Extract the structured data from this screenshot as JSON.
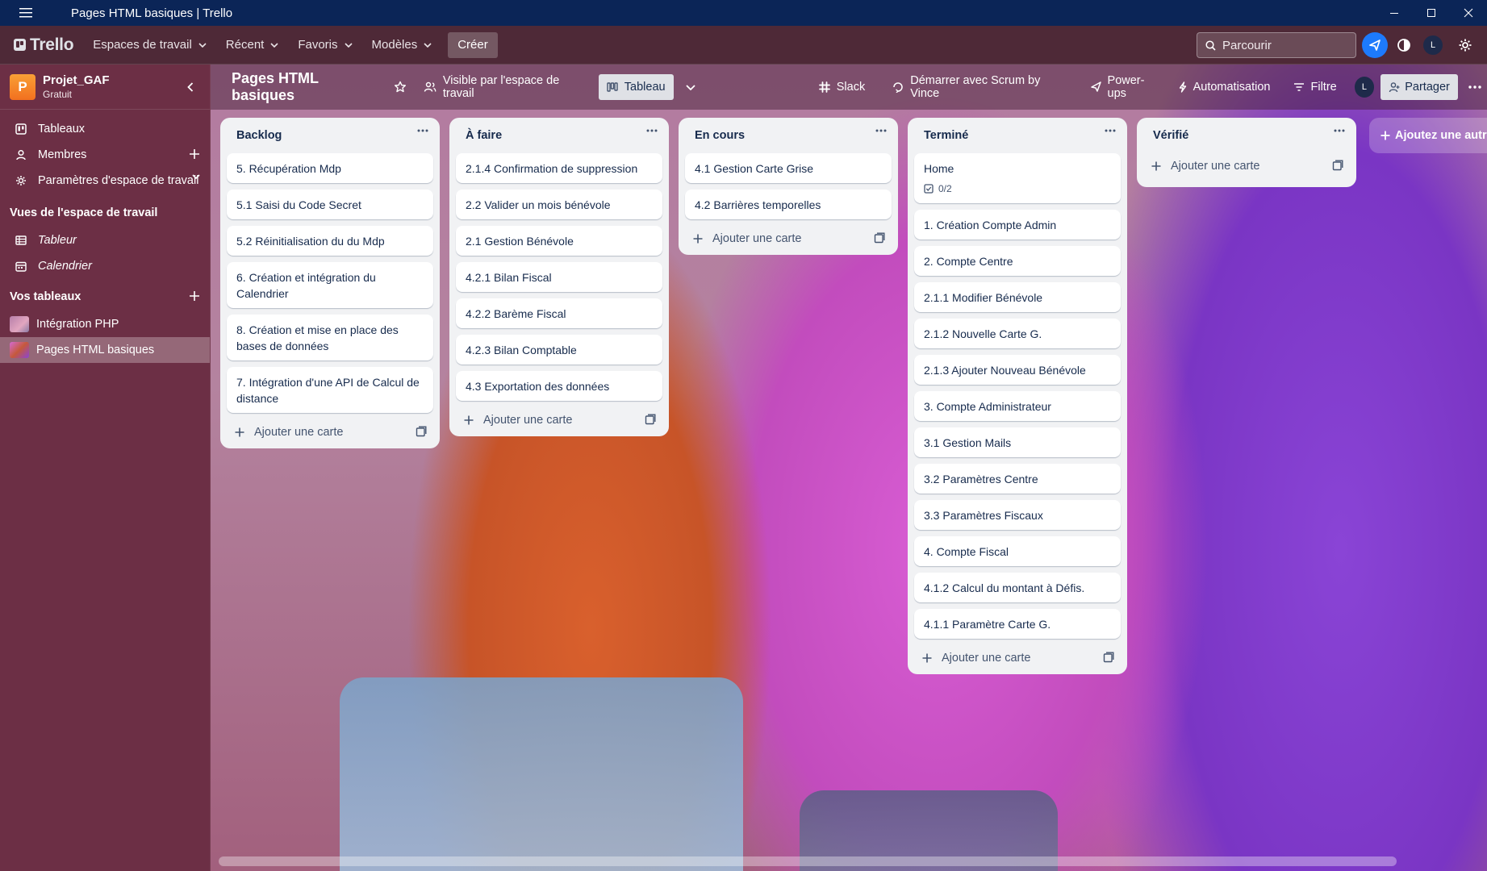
{
  "window": {
    "title": "Pages HTML basiques | Trello"
  },
  "topnav": {
    "logo": "Trello",
    "items": [
      {
        "label": "Espaces de travail"
      },
      {
        "label": "Récent"
      },
      {
        "label": "Favoris"
      },
      {
        "label": "Modèles"
      }
    ],
    "create_label": "Créer",
    "search_placeholder": "Parcourir",
    "avatar_initial": "L"
  },
  "sidebar": {
    "workspace": {
      "initial": "P",
      "name": "Projet_GAF",
      "plan": "Gratuit"
    },
    "items": [
      {
        "label": "Tableaux",
        "icon": "trello-board-icon"
      },
      {
        "label": "Membres",
        "icon": "person-icon"
      },
      {
        "label": "Paramètres d'espace de travail",
        "icon": "gear-icon"
      }
    ],
    "views_title": "Vues de l'espace de travail",
    "views": [
      {
        "label": "Tableur",
        "icon": "table-icon"
      },
      {
        "label": "Calendrier",
        "icon": "calendar-icon"
      }
    ],
    "boards_title": "Vos tableaux",
    "boards": [
      {
        "label": "Intégration PHP"
      },
      {
        "label": "Pages HTML basiques"
      }
    ]
  },
  "board": {
    "title": "Pages HTML basiques",
    "visibility": "Visible par l'espace de travail",
    "view": "Tableau",
    "slack": "Slack",
    "scrum": "Démarrer avec Scrum by Vince",
    "powerups": "Power-ups",
    "automation": "Automatisation",
    "filter": "Filtre",
    "member_initial": "L",
    "share": "Partager",
    "add_list": "Ajoutez une autre"
  },
  "lists": [
    {
      "title": "Backlog",
      "cards": [
        {
          "title": "5. Récupération Mdp"
        },
        {
          "title": "5.1 Saisi du Code Secret"
        },
        {
          "title": "5.2 Réinitialisation du du Mdp"
        },
        {
          "title": "6. Création et intégration du Calendrier"
        },
        {
          "title": "8. Création et mise en place des bases de données"
        },
        {
          "title": "7. Intégration d'une API de Calcul de distance"
        }
      ],
      "add_label": "Ajouter une carte"
    },
    {
      "title": "À faire",
      "cards": [
        {
          "title": "2.1.4 Confirmation de suppression"
        },
        {
          "title": "2.2 Valider un mois bénévole"
        },
        {
          "title": "2.1 Gestion Bénévole"
        },
        {
          "title": "4.2.1 Bilan Fiscal"
        },
        {
          "title": "4.2.2 Barème Fiscal"
        },
        {
          "title": "4.2.3 Bilan Comptable"
        },
        {
          "title": "4.3 Exportation des données"
        }
      ],
      "add_label": "Ajouter une carte"
    },
    {
      "title": "En cours",
      "cards": [
        {
          "title": "4.1 Gestion Carte Grise"
        },
        {
          "title": "4.2 Barrières temporelles"
        }
      ],
      "add_label": "Ajouter une carte"
    },
    {
      "title": "Terminé",
      "cards": [
        {
          "title": "Home",
          "checklist": "0/2"
        },
        {
          "title": "1. Création Compte Admin"
        },
        {
          "title": "2. Compte Centre"
        },
        {
          "title": "2.1.1 Modifier Bénévole"
        },
        {
          "title": "2.1.2 Nouvelle Carte G."
        },
        {
          "title": "2.1.3 Ajouter Nouveau Bénévole"
        },
        {
          "title": "3. Compte Administrateur"
        },
        {
          "title": "3.1 Gestion Mails"
        },
        {
          "title": "3.2 Paramètres Centre"
        },
        {
          "title": "3.3 Paramètres Fiscaux"
        },
        {
          "title": "4. Compte Fiscal"
        },
        {
          "title": "4.1.2 Calcul du montant à Défis."
        },
        {
          "title": "4.1.1 Paramètre Carte G."
        }
      ],
      "add_label": "Ajouter une carte"
    },
    {
      "title": "Vérifié",
      "cards": [],
      "add_label": "Ajouter une carte"
    }
  ],
  "colors": {
    "titlebar": "#0b2557",
    "topnav": "#4e2937",
    "sidebar": "#6c2f45",
    "accent": "#1d7afc",
    "list_bg": "#f1f2f4"
  }
}
